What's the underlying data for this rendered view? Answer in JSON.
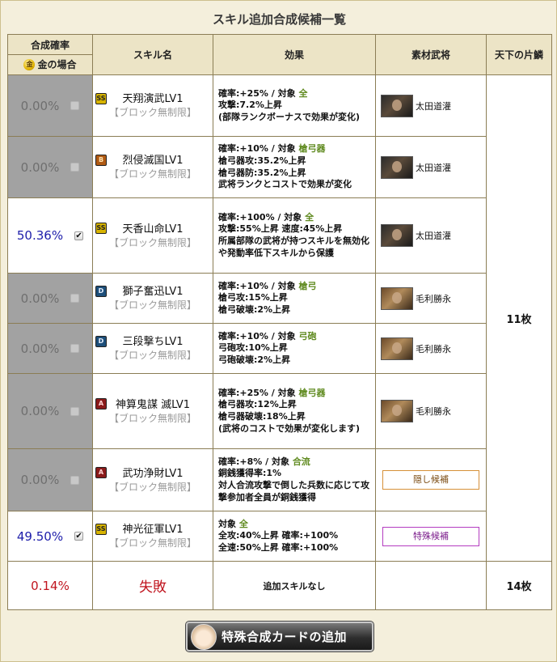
{
  "title": "スキル追加合成候補一覧",
  "headers": {
    "rate_top": "合成確率",
    "rate_bottom": "金の場合",
    "coin_icon_text": "金",
    "skill": "スキル名",
    "effect": "効果",
    "material": "素材武将",
    "tenka": "天下の片鱗"
  },
  "rows": [
    {
      "rate": "0.00%",
      "checked": false,
      "rank": "SS",
      "name": "天翔演武LV1",
      "note": "【ブロック無制限】",
      "effect": [
        "確率:+25% / 対象 ",
        "攻撃:7.2%上昇",
        "(部隊ランクボーナスで効果が変化)"
      ],
      "target": "全",
      "material": "太田道灌"
    },
    {
      "rate": "0.00%",
      "checked": false,
      "rank": "B",
      "name": "烈侵滅国LV1",
      "note": "【ブロック無制限】",
      "effect": [
        "確率:+10% / 対象 ",
        "槍弓器攻:35.2%上昇",
        "槍弓器防:35.2%上昇",
        "武将ランクとコストで効果が変化"
      ],
      "target": "槍弓器",
      "material": "太田道灌"
    },
    {
      "rate": "50.36%",
      "checked": true,
      "rank": "SS",
      "name": "天香山命LV1",
      "note": "【ブロック無制限】",
      "effect": [
        "確率:+100% / 対象 ",
        "攻撃:55%上昇 速度:45%上昇",
        "所属部隊の武将が持つスキルを無効化や発動率低下スキルから保護"
      ],
      "target": "全",
      "material": "太田道灌"
    },
    {
      "rate": "0.00%",
      "checked": false,
      "rank": "D",
      "name": "獅子奮迅LV1",
      "note": "【ブロック無制限】",
      "effect": [
        "確率:+10% / 対象 ",
        "槍弓攻:15%上昇",
        "槍弓破壊:2%上昇"
      ],
      "target": "槍弓",
      "material": "毛利勝永"
    },
    {
      "rate": "0.00%",
      "checked": false,
      "rank": "D",
      "name": "三段撃ちLV1",
      "note": "【ブロック無制限】",
      "effect": [
        "確率:+10% / 対象 ",
        "弓砲攻:10%上昇",
        "弓砲破壊:2%上昇"
      ],
      "target": "弓砲",
      "material": "毛利勝永"
    },
    {
      "rate": "0.00%",
      "checked": false,
      "rank": "A",
      "name": "神算鬼謀 滅LV1",
      "note": "【ブロック無制限】",
      "effect": [
        "確率:+25% / 対象 ",
        "槍弓器攻:12%上昇",
        "槍弓器破壊:18%上昇",
        "(武将のコストで効果が変化します)"
      ],
      "target": "槍弓器",
      "material": "毛利勝永"
    },
    {
      "rate": "0.00%",
      "checked": false,
      "rank": "A",
      "name": "武功浄財LV1",
      "note": "【ブロック無制限】",
      "effect": [
        "確率:+8% / 対象 ",
        "銅銭獲得率:1%",
        "対人合流攻撃で倒した兵数に応じて攻撃参加者全員が銅銭獲得"
      ],
      "target": "合流",
      "candidate": "隠し候補"
    },
    {
      "rate": "49.50%",
      "checked": true,
      "rank": "SS",
      "name": "神光征軍LV1",
      "note": "【ブロック無制限】",
      "effect": [
        "対象 ",
        "全攻:40%上昇 確率:+100%",
        "全速:50%上昇 確率:+100%"
      ],
      "target": "全",
      "candidate": "特殊候補"
    }
  ],
  "tenka_count_skills": "11枚",
  "fail": {
    "rate": "0.14%",
    "label": "失敗",
    "effect": "追加スキルなし",
    "tenka": "14枚"
  },
  "add_card_button": "特殊合成カードの追加",
  "colors": {
    "accent_red": "#c0141e",
    "rate_blue": "#1d1daa",
    "target_green": "#5f8a1f",
    "disabled_gray": "#a2a2a2",
    "header_tan": "#ece4c6"
  },
  "icons": {
    "coin": "gold-coin-icon",
    "checkbox": "checkbox-icon",
    "portrait": "general-portrait"
  }
}
